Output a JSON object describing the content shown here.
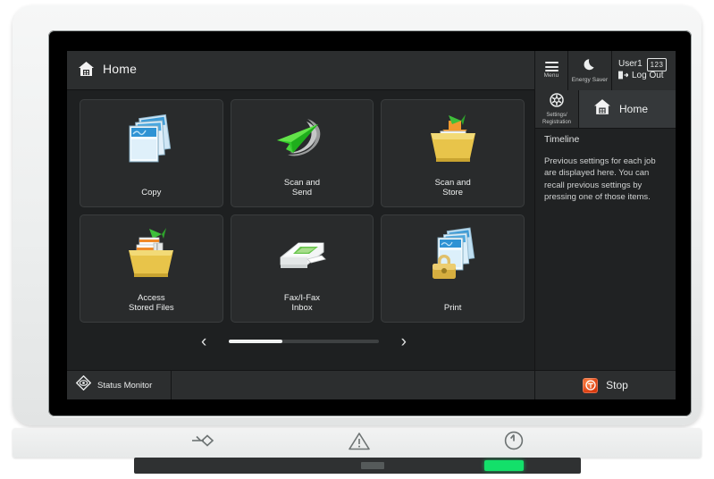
{
  "device": {
    "name": "multifunction-printer-control-panel",
    "bezel_controls": [
      {
        "name": "data-job-indicator",
        "glyph": "arrow-into-diamond"
      },
      {
        "name": "error-warning-indicator",
        "glyph": "warning-triangle"
      },
      {
        "name": "power-button",
        "glyph": "power"
      }
    ],
    "led_label": ""
  },
  "header": {
    "title": "Home",
    "home_icon": "home-icon"
  },
  "top_buttons": {
    "menu_label": "Menu",
    "energy_saver_label": "Energy Saver",
    "user_name": "User1",
    "logout_label": "Log Out"
  },
  "row2": {
    "settings_label_line1": "Settings/",
    "settings_label_line2": "Registration",
    "home_label": "Home"
  },
  "timeline": {
    "heading": "Timeline",
    "body": "Previous settings for each job are displayed here. You can recall previous settings by pressing one of those items."
  },
  "stop": {
    "label": "Stop"
  },
  "tiles": [
    {
      "id": "copy",
      "label": "Copy",
      "icon": "documents-stack-icon"
    },
    {
      "id": "scan-and-send",
      "label": "Scan and\nSend",
      "icon": "paper-plane-icon"
    },
    {
      "id": "scan-and-store",
      "label": "Scan and\nStore",
      "icon": "box-inbound-icon"
    },
    {
      "id": "access-stored-files",
      "label": "Access\nStored Files",
      "icon": "box-files-icon"
    },
    {
      "id": "fax-ifax-inbox",
      "label": "Fax/I-Fax\nInbox",
      "icon": "fax-machine-icon"
    },
    {
      "id": "print",
      "label": "Print",
      "icon": "documents-lock-icon"
    }
  ],
  "pager": {
    "prev": "‹",
    "next": "›",
    "progress_percent": 36
  },
  "statusbar": {
    "status_monitor_label": "Status Monitor",
    "keypad_label": "123"
  },
  "colors": {
    "screen_bg": "#1e2021",
    "panel_bg": "#2c2e2f",
    "tile_bg": "#292b2c",
    "accent_green": "#35d24a",
    "accent_yellow": "#e8c44a",
    "accent_blue": "#4aa8e0",
    "stop_red": "#d8380c",
    "led_green": "#13e06a"
  }
}
